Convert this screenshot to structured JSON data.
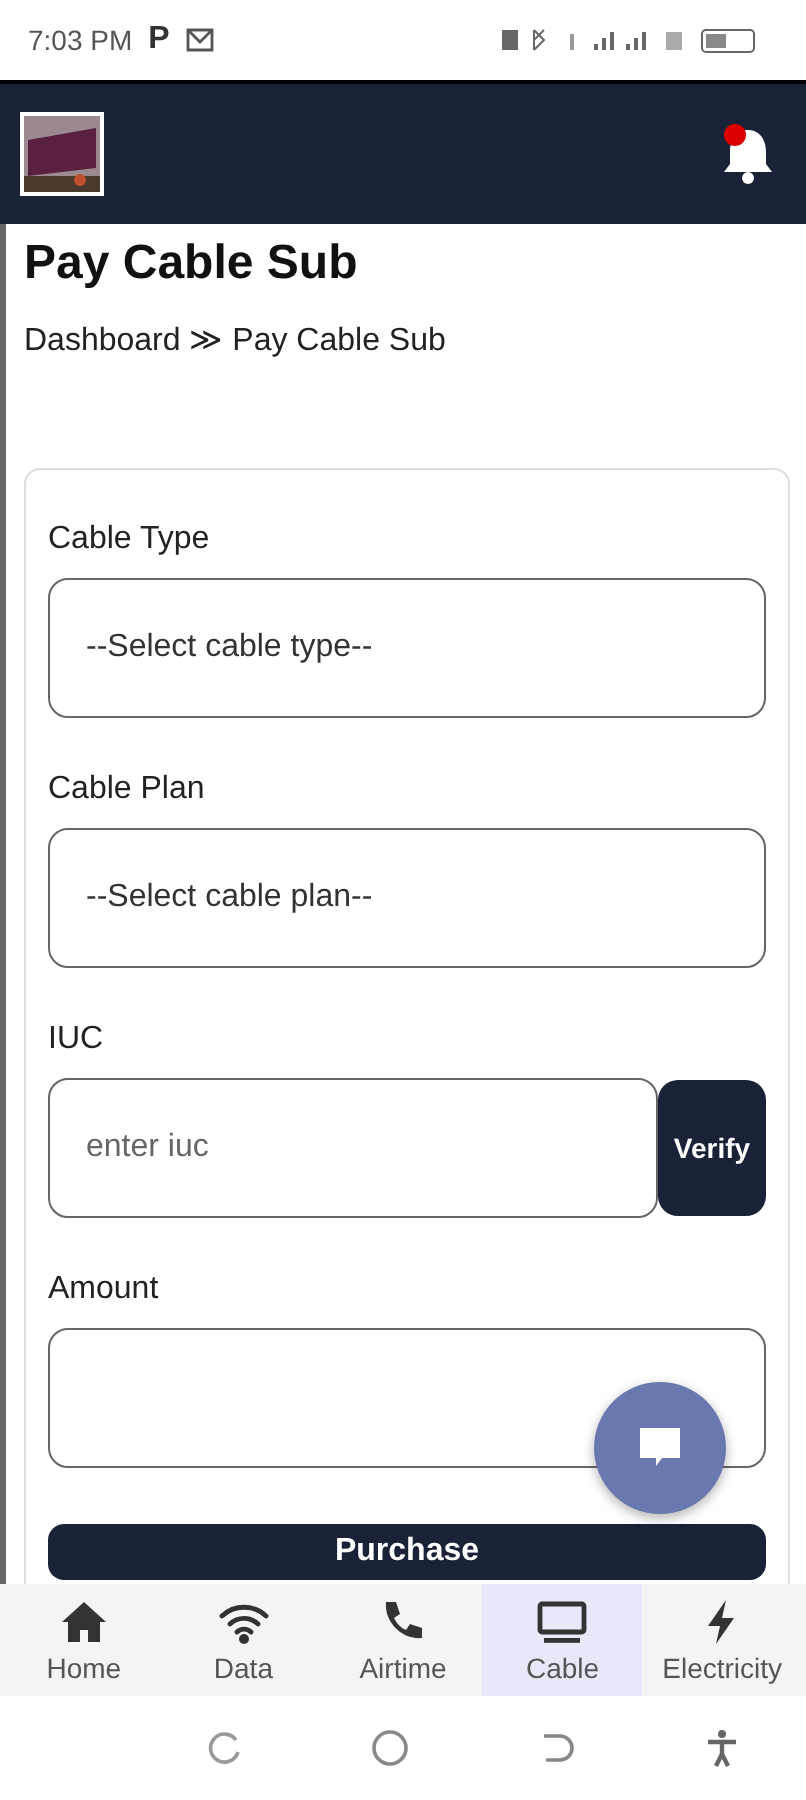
{
  "status_bar": {
    "time": "7:03 PM",
    "app_letter": "P"
  },
  "header": {
    "notification_dot": true
  },
  "page": {
    "title": "Pay Cable Sub",
    "breadcrumb": "Dashboard ≫ Pay Cable Sub"
  },
  "form": {
    "fields": [
      {
        "kind": "select",
        "label": "Cable Type",
        "placeholder": "--Select cable type--"
      },
      {
        "kind": "select",
        "label": "Cable Plan",
        "placeholder": "--Select cable plan--"
      },
      {
        "kind": "verify",
        "label": "IUC",
        "placeholder": "enter iuc",
        "button": "Verify"
      },
      {
        "kind": "text",
        "label": "Amount"
      }
    ],
    "submit": "Purchase"
  },
  "bottom_nav": [
    {
      "label": "Home",
      "selected": false
    },
    {
      "label": "Data",
      "selected": false
    },
    {
      "label": "Airtime",
      "selected": false
    },
    {
      "label": "Cable",
      "selected": true
    },
    {
      "label": "Electricity",
      "selected": false
    }
  ]
}
